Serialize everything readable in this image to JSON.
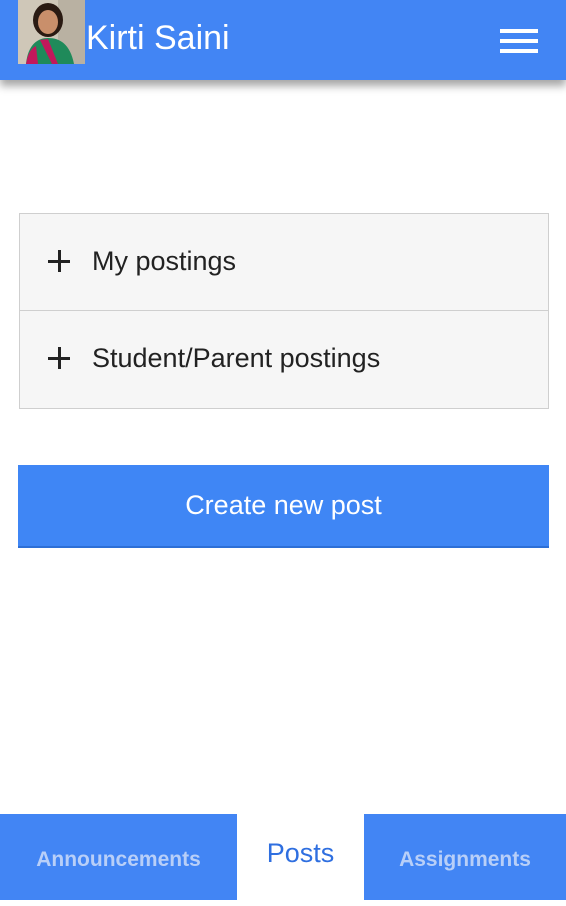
{
  "header": {
    "title": "Kirti Saini",
    "avatar_icon": "user-photo",
    "menu_icon": "hamburger-menu-icon",
    "bg_color": "#4285f4"
  },
  "accordion": {
    "items": [
      {
        "label": "My postings",
        "icon": "plus-icon"
      },
      {
        "label": "Student/Parent postings",
        "icon": "plus-icon"
      }
    ]
  },
  "actions": {
    "create_label": "Create new post",
    "button_color": "#3f86f5"
  },
  "tabs": {
    "items": [
      {
        "label": "Announcements",
        "active": false
      },
      {
        "label": "Posts",
        "active": true
      },
      {
        "label": "Assignments",
        "active": false
      }
    ]
  }
}
